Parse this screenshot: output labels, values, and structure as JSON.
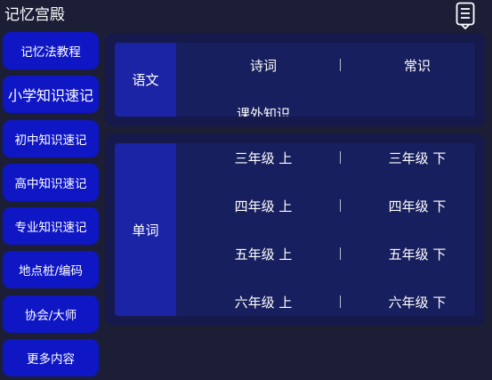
{
  "app": {
    "title": "记忆宫殿"
  },
  "header": {
    "menu_icon": "document-list-icon"
  },
  "sidebar": {
    "items": [
      {
        "label": "记忆法教程"
      },
      {
        "label": "小学知识速记",
        "active": true
      },
      {
        "label": "初中知识速记"
      },
      {
        "label": "高中知识速记"
      },
      {
        "label": "专业知识速记"
      },
      {
        "label": "地点桩/编码"
      },
      {
        "label": "协会/大师"
      },
      {
        "label": "更多内容"
      }
    ]
  },
  "yuwen": {
    "category": "语文",
    "items": [
      "诗词",
      "常识",
      "课外知识"
    ]
  },
  "danci": {
    "category": "单词",
    "items": [
      "三年级 上",
      "三年级 下",
      "四年级 上",
      "四年级 下",
      "五年级 上",
      "五年级 下",
      "六年级 上",
      "六年级 下"
    ]
  },
  "colors": {
    "background": "#1b1e35",
    "nav_button": "#0f16c4",
    "card": "#15194c",
    "category_column": "#1b24a4"
  }
}
